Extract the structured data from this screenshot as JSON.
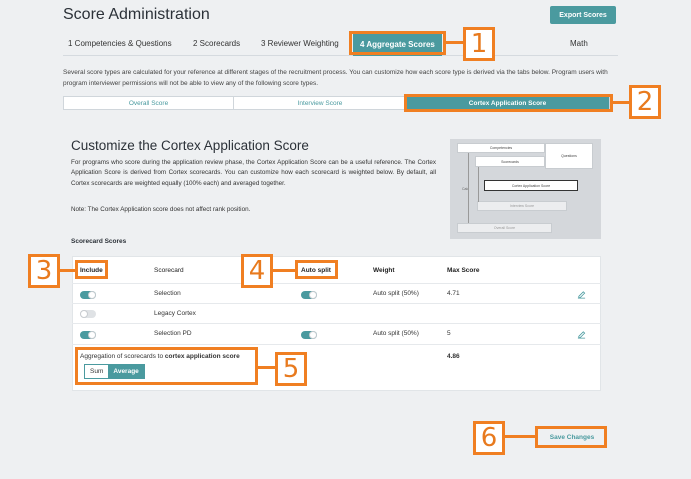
{
  "header": {
    "title": "Score Administration",
    "export_label": "Export Scores"
  },
  "tabs": [
    {
      "label": "1 Competencies & Questions"
    },
    {
      "label": "2 Scorecards"
    },
    {
      "label": "3 Reviewer Weighting"
    },
    {
      "label": "4 Aggregate Scores",
      "active": true
    },
    {
      "label": "Math"
    }
  ],
  "description": "Several score types are calculated for your reference at different stages of the recruitment process. You can customize how each score type is derived via the tabs below. Program users with program interviewer permissions will not be able to view any of the following score types.",
  "subtabs": [
    {
      "label": "Overall Score"
    },
    {
      "label": "Interview Score"
    },
    {
      "label": "Cortex Application Score",
      "active": true
    }
  ],
  "section": {
    "title": "Customize the Cortex Application Score",
    "body": "For programs who score during the application review phase, the Cortex Application Score can be a useful reference. The Cortex Application Score is derived from Cortex scorecards. You can customize how each scorecard is weighted below. By default, all Cortex scorecards are weighted equally (100% each) and averaged together.",
    "note": "Note: The Cortex Application score does not affect rank position."
  },
  "diagram": {
    "competencies": "Competencies",
    "questions": "Questions",
    "scorecards": "Scorecards",
    "cortex_app_score": "Cortex Application Score",
    "interview_score": "Interview Score",
    "overall_score": "Overall Score",
    "side_label": "Calc"
  },
  "scorecards": {
    "label": "Scorecard Scores",
    "columns": {
      "include": "Include",
      "scorecard": "Scorecard",
      "auto_split": "Auto split",
      "weight": "Weight",
      "max_score": "Max Score"
    },
    "rows": [
      {
        "include": true,
        "name": "Selection",
        "auto_split": true,
        "weight": "Auto split (50%)",
        "max": "4.71",
        "editable": true
      },
      {
        "include": false,
        "name": "Legacy Cortex",
        "auto_split": null,
        "weight": "",
        "max": "",
        "editable": false
      },
      {
        "include": true,
        "name": "Selection PD",
        "auto_split": true,
        "weight": "Auto split (50%)",
        "max": "5",
        "editable": true
      }
    ],
    "aggregation_prefix": "Aggregation of scorecards to ",
    "aggregation_target": "cortex application score",
    "sum_label": "Sum",
    "average_label": "Average",
    "selected_method": "Average",
    "total_max": "4.86"
  },
  "save_label": "Save Changes",
  "callouts": [
    "1",
    "2",
    "3",
    "4",
    "5",
    "6"
  ],
  "colors": {
    "accent": "#4a9a9f",
    "highlight": "#f07f22",
    "background": "#eef0f2"
  }
}
